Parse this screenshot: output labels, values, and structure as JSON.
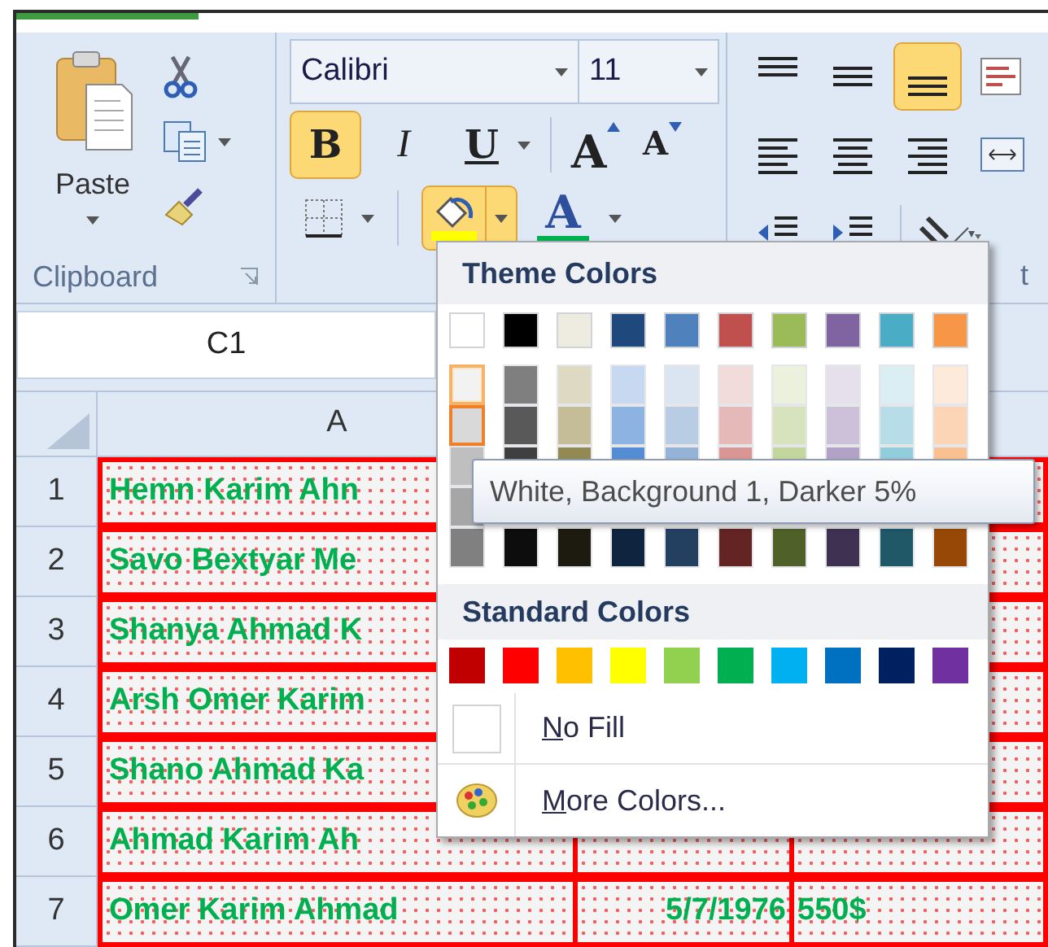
{
  "ribbon": {
    "clipboard": {
      "paste_label": "Paste",
      "group_label": "Clipboard"
    },
    "font": {
      "font_name": "Calibri",
      "font_size": "11",
      "bold": {
        "label": "B",
        "selected": true
      },
      "italic": {
        "label": "I",
        "selected": false
      },
      "underline": {
        "label": "U",
        "selected": false
      },
      "grow_font": "A",
      "shrink_font": "A",
      "fill_color": {
        "selected": true,
        "color": "#ffff00"
      },
      "font_color": {
        "label": "A",
        "color": "#00b050"
      }
    },
    "alignment": {
      "rows": [
        [
          {
            "kind": "top-align",
            "selected": false
          },
          {
            "kind": "middle-align",
            "selected": false
          },
          {
            "kind": "bottom-align",
            "selected": true
          },
          {
            "kind": "wrap-text",
            "selected": false
          }
        ],
        [
          {
            "kind": "align-left",
            "selected": false
          },
          {
            "kind": "align-center",
            "selected": false
          },
          {
            "kind": "align-right",
            "selected": false
          },
          {
            "kind": "merge",
            "selected": false
          }
        ],
        [
          {
            "kind": "decrease-indent",
            "selected": false
          },
          {
            "kind": "increase-indent",
            "selected": false
          },
          {
            "kind": "orientation",
            "selected": false
          }
        ]
      ],
      "group_label": "t"
    }
  },
  "name_box": "C1",
  "columns": [
    {
      "label": "A"
    }
  ],
  "rows": [
    {
      "number": "1",
      "name": "Hemn Karim Ahn"
    },
    {
      "number": "2",
      "name": "Savo Bextyar Me"
    },
    {
      "number": "3",
      "name": "Shanya Ahmad K"
    },
    {
      "number": "4",
      "name": "Arsh Omer Karim"
    },
    {
      "number": "5",
      "name": "Shano Ahmad Ka"
    },
    {
      "number": "6",
      "name": "Ahmad Karim Ah"
    },
    {
      "number": "7",
      "name": "Omer Karim Ahmad",
      "date": "5/7/1976",
      "amount": "550$"
    }
  ],
  "fill_menu": {
    "theme_title": "Theme Colors",
    "theme_colors": [
      {
        "color": "#ffffff",
        "shades": [
          {
            "color": "#f2f2f2",
            "selected": false,
            "hovered": true
          },
          {
            "color": "#d9d9d9",
            "selected": true,
            "hovered": false
          },
          {
            "color": "#bfbfbf",
            "selected": false,
            "hovered": false
          }
        ],
        "shade_4": {
          "color": "#a6a6a6",
          "selected": false,
          "hovered": false
        },
        "shade_5": {
          "color": "#808080",
          "selected": false,
          "hovered": false
        }
      },
      {
        "color": "#000000",
        "shades": [
          {
            "color": "#7f7f7f",
            "selected": false,
            "hovered": false
          },
          {
            "color": "#595959",
            "selected": false,
            "hovered": false
          },
          {
            "color": "#3f3f3f",
            "selected": false,
            "hovered": false
          }
        ],
        "shade_5": {
          "color": "#0d0d0d",
          "selected": false,
          "hovered": false
        }
      },
      {
        "color": "#eeece1",
        "shades": [
          {
            "color": "#ddd9c3",
            "selected": false,
            "hovered": false
          },
          {
            "color": "#c4bd97",
            "selected": false,
            "hovered": false
          },
          {
            "color": "#938953",
            "selected": false,
            "hovered": false
          }
        ],
        "shade_5": {
          "color": "#1d1b10",
          "selected": false,
          "hovered": false
        }
      },
      {
        "color": "#1f497d",
        "shades": [
          {
            "color": "#c6d9f0",
            "selected": false,
            "hovered": false
          },
          {
            "color": "#8db3e2",
            "selected": false,
            "hovered": false
          },
          {
            "color": "#548dd4",
            "selected": false,
            "hovered": false
          }
        ],
        "shade_5": {
          "color": "#0f243e",
          "selected": false,
          "hovered": false
        }
      },
      {
        "color": "#4f81bd",
        "shades": [
          {
            "color": "#dbe5f1",
            "selected": false,
            "hovered": false
          },
          {
            "color": "#b8cce4",
            "selected": false,
            "hovered": false
          },
          {
            "color": "#95b3d7",
            "selected": false,
            "hovered": false
          }
        ],
        "shade_5": {
          "color": "#244061",
          "selected": false,
          "hovered": false
        }
      },
      {
        "color": "#c0504d",
        "shades": [
          {
            "color": "#f2dcdb",
            "selected": false,
            "hovered": false
          },
          {
            "color": "#e5b9b7",
            "selected": false,
            "hovered": false
          },
          {
            "color": "#d99694",
            "selected": false,
            "hovered": false
          }
        ],
        "shade_5": {
          "color": "#632423",
          "selected": false,
          "hovered": false
        }
      },
      {
        "color": "#9bbb59",
        "shades": [
          {
            "color": "#ebf1dd",
            "selected": false,
            "hovered": false
          },
          {
            "color": "#d7e3bc",
            "selected": false,
            "hovered": false
          },
          {
            "color": "#c3d69b",
            "selected": false,
            "hovered": false
          }
        ],
        "shade_5": {
          "color": "#4f6128",
          "selected": false,
          "hovered": false
        }
      },
      {
        "color": "#8064a2",
        "shades": [
          {
            "color": "#e5e0ec",
            "selected": false,
            "hovered": false
          },
          {
            "color": "#ccc1d9",
            "selected": false,
            "hovered": false
          },
          {
            "color": "#b2a2c7",
            "selected": false,
            "hovered": false
          }
        ],
        "shade_5": {
          "color": "#3f3151",
          "selected": false,
          "hovered": false
        }
      },
      {
        "color": "#4bacc6",
        "shades": [
          {
            "color": "#dbeef3",
            "selected": false,
            "hovered": false
          },
          {
            "color": "#b7dde8",
            "selected": false,
            "hovered": false
          },
          {
            "color": "#92cddc",
            "selected": false,
            "hovered": false
          }
        ],
        "shade_5": {
          "color": "#205867",
          "selected": false,
          "hovered": false
        }
      },
      {
        "color": "#f79646",
        "shades": [
          {
            "color": "#fdeada",
            "selected": false,
            "hovered": false
          },
          {
            "color": "#fbd5b5",
            "selected": false,
            "hovered": false
          },
          {
            "color": "#fac08f",
            "selected": false,
            "hovered": false
          }
        ],
        "shade_5": {
          "color": "#974806",
          "selected": false,
          "hovered": false
        }
      }
    ],
    "standard_title": "Standard Colors",
    "standard_colors": [
      {
        "color": "#c00000"
      },
      {
        "color": "#ff0000"
      },
      {
        "color": "#ffc000"
      },
      {
        "color": "#ffff00"
      },
      {
        "color": "#92d050"
      },
      {
        "color": "#00b050"
      },
      {
        "color": "#00b0f0"
      },
      {
        "color": "#0070c0"
      },
      {
        "color": "#002060"
      },
      {
        "color": "#7030a0"
      }
    ],
    "no_fill": {
      "label": "No Fill",
      "mnemonic_underlined": true
    },
    "more_colors": {
      "label": "More Colors...",
      "mnemonic_underlined": true
    }
  },
  "tooltip": "White, Background 1, Darker 5%"
}
